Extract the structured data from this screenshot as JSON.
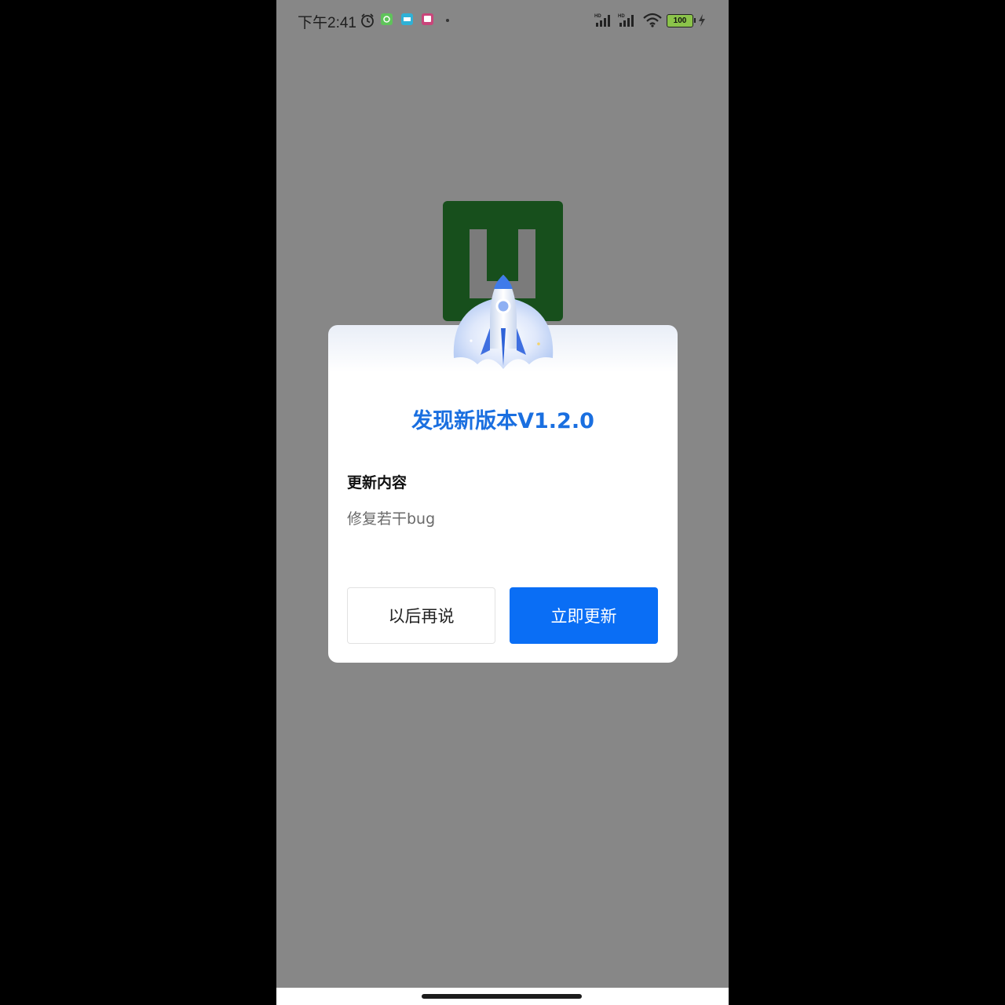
{
  "status_bar": {
    "time": "下午2:41",
    "battery": "100",
    "icons": [
      "alarm-icon",
      "notification-app-icon",
      "notification-app-icon",
      "notification-app-icon",
      "signal-hd-icon",
      "signal-hd-icon",
      "wifi-icon",
      "battery-icon",
      "charging-icon"
    ]
  },
  "app_logo": {
    "icon": "app-logo-icon",
    "color": "#174f1c"
  },
  "update_dialog": {
    "title": "发现新版本V1.2.0",
    "section_label": "更新内容",
    "content": "修复若干bug",
    "later_button": "以后再说",
    "update_button": "立即更新",
    "accent_color": "#0a6ef5",
    "title_color": "#1a6fe0"
  }
}
